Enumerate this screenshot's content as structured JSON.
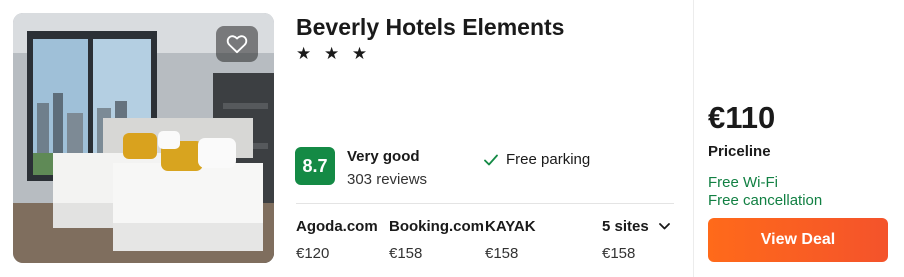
{
  "hotel": {
    "name": "Beverly Hotels Elements",
    "stars": "★ ★ ★",
    "rating_score": "8.7",
    "rating_label": "Very good",
    "reviews": "303 reviews",
    "amenity": "Free parking",
    "accent_color": "#148a45",
    "icons": {
      "favorite": "heart-icon",
      "amenity": "check-icon",
      "sites_toggle": "chevron-down-icon"
    }
  },
  "sites": [
    {
      "name": "Agoda.com",
      "price": "€120"
    },
    {
      "name": "Booking.com",
      "price": "€158"
    },
    {
      "name": "KAYAK",
      "price": "€158"
    }
  ],
  "more_sites": {
    "label": "5 sites",
    "price": "€158"
  },
  "deal": {
    "price": "€110",
    "provider": "Priceline",
    "perks": [
      "Free Wi-Fi",
      "Free cancellation"
    ],
    "button_label": "View Deal",
    "button_color": "#ff6a1a"
  }
}
